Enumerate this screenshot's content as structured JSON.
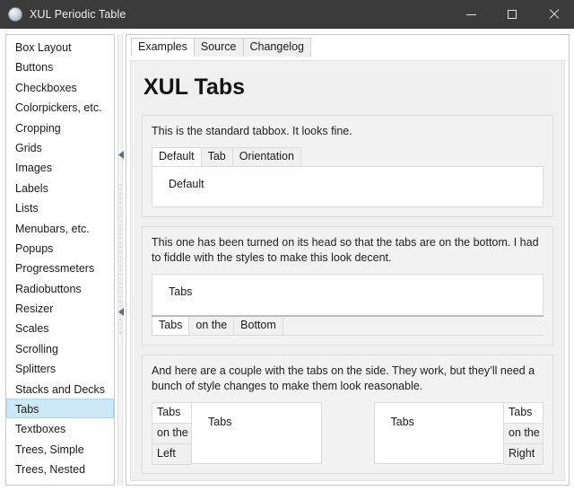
{
  "window": {
    "title": "XUL Periodic Table",
    "icon": "sphere-icon",
    "controls": {
      "minimize": "minimize-icon",
      "maximize": "maximize-icon",
      "close": "close-icon"
    }
  },
  "colors": {
    "titlebar_bg": "#3b3b3b",
    "titlebar_fg": "#f0f0f0",
    "selection_bg": "#cce8f7",
    "selection_border": "#a8d8ef",
    "panel_bg": "#f0f0f0",
    "group_bg": "#f2f2f2",
    "tab_inactive_bg": "#f0f0f0",
    "tab_active_bg": "#ffffff",
    "border": "#c8c8c8"
  },
  "sidebar": {
    "selected": "Tabs",
    "items": [
      {
        "label": "Box Layout"
      },
      {
        "label": "Buttons"
      },
      {
        "label": "Checkboxes"
      },
      {
        "label": "Colorpickers, etc."
      },
      {
        "label": "Cropping"
      },
      {
        "label": "Grids"
      },
      {
        "label": "Images"
      },
      {
        "label": "Labels"
      },
      {
        "label": "Lists"
      },
      {
        "label": "Menubars, etc."
      },
      {
        "label": "Popups"
      },
      {
        "label": "Progressmeters"
      },
      {
        "label": "Radiobuttons"
      },
      {
        "label": "Resizer"
      },
      {
        "label": "Scales"
      },
      {
        "label": "Scrolling"
      },
      {
        "label": "Splitters"
      },
      {
        "label": "Stacks and Decks"
      },
      {
        "label": "Tabs"
      },
      {
        "label": "Textboxes"
      },
      {
        "label": "Trees, Simple"
      },
      {
        "label": "Trees, Nested"
      }
    ]
  },
  "splitter": {
    "name": "sidebar-splitter",
    "collapse_up": "collapse-up-arrow",
    "collapse_down": "collapse-down-arrow"
  },
  "main": {
    "tabs": [
      {
        "label": "Examples",
        "active": true
      },
      {
        "label": "Source",
        "active": false
      },
      {
        "label": "Changelog",
        "active": false
      }
    ],
    "title": "XUL Tabs",
    "groups": [
      {
        "note": "This is the standard tabbox. It looks fine.",
        "tabs": [
          {
            "label": "Default",
            "active": true
          },
          {
            "label": "Tab",
            "active": false
          },
          {
            "label": "Orientation",
            "active": false
          }
        ],
        "content": "Default"
      },
      {
        "note": "This one has been turned on its head so that the tabs are on the bottom. I had to fiddle with the styles to make this look decent.",
        "tabs": [
          {
            "label": "Tabs",
            "active": true
          },
          {
            "label": "on the",
            "active": false
          },
          {
            "label": "Bottom",
            "active": false
          }
        ],
        "content": "Tabs"
      },
      {
        "note": "And here are a couple with the tabs on the side. They work, but they’ll need a bunch of style changes to make them look reasonable.",
        "left_box": {
          "tabs": [
            {
              "label": "Tabs",
              "active": true
            },
            {
              "label": "on the",
              "active": false
            },
            {
              "label": "Left",
              "active": false
            }
          ],
          "content": "Tabs"
        },
        "right_box": {
          "tabs": [
            {
              "label": "Tabs",
              "active": true
            },
            {
              "label": "on the",
              "active": false
            },
            {
              "label": "Right",
              "active": false
            }
          ],
          "content": "Tabs"
        }
      }
    ]
  }
}
